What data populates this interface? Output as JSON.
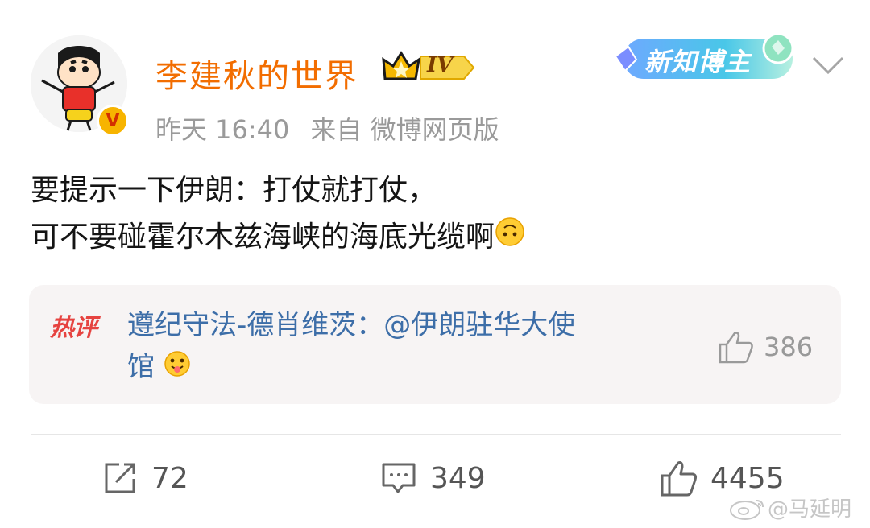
{
  "post": {
    "username": "李建秋的世界",
    "level_badge": "IV",
    "verified_badge": "V",
    "creator_badge": "新知博主",
    "time": "昨天 16:40",
    "source": "来自 微博网页版",
    "body_line1": "要提示一下伊朗：打仗就打仗，",
    "body_line2": "可不要碰霍尔木兹海峡的海底光缆啊"
  },
  "hot_comment": {
    "tag": "热评",
    "text_line1": "遵纪守法-德肖维茨：@伊朗驻华大使",
    "text_line2": "馆",
    "likes": "386"
  },
  "actions": {
    "repost_count": "72",
    "comment_count": "349",
    "like_count": "4455"
  },
  "watermark": "@马延明",
  "colors": {
    "username": "#f26d00",
    "link": "#3d6ea8",
    "hot_tag": "#e64340",
    "meta": "#9a9a9a"
  }
}
